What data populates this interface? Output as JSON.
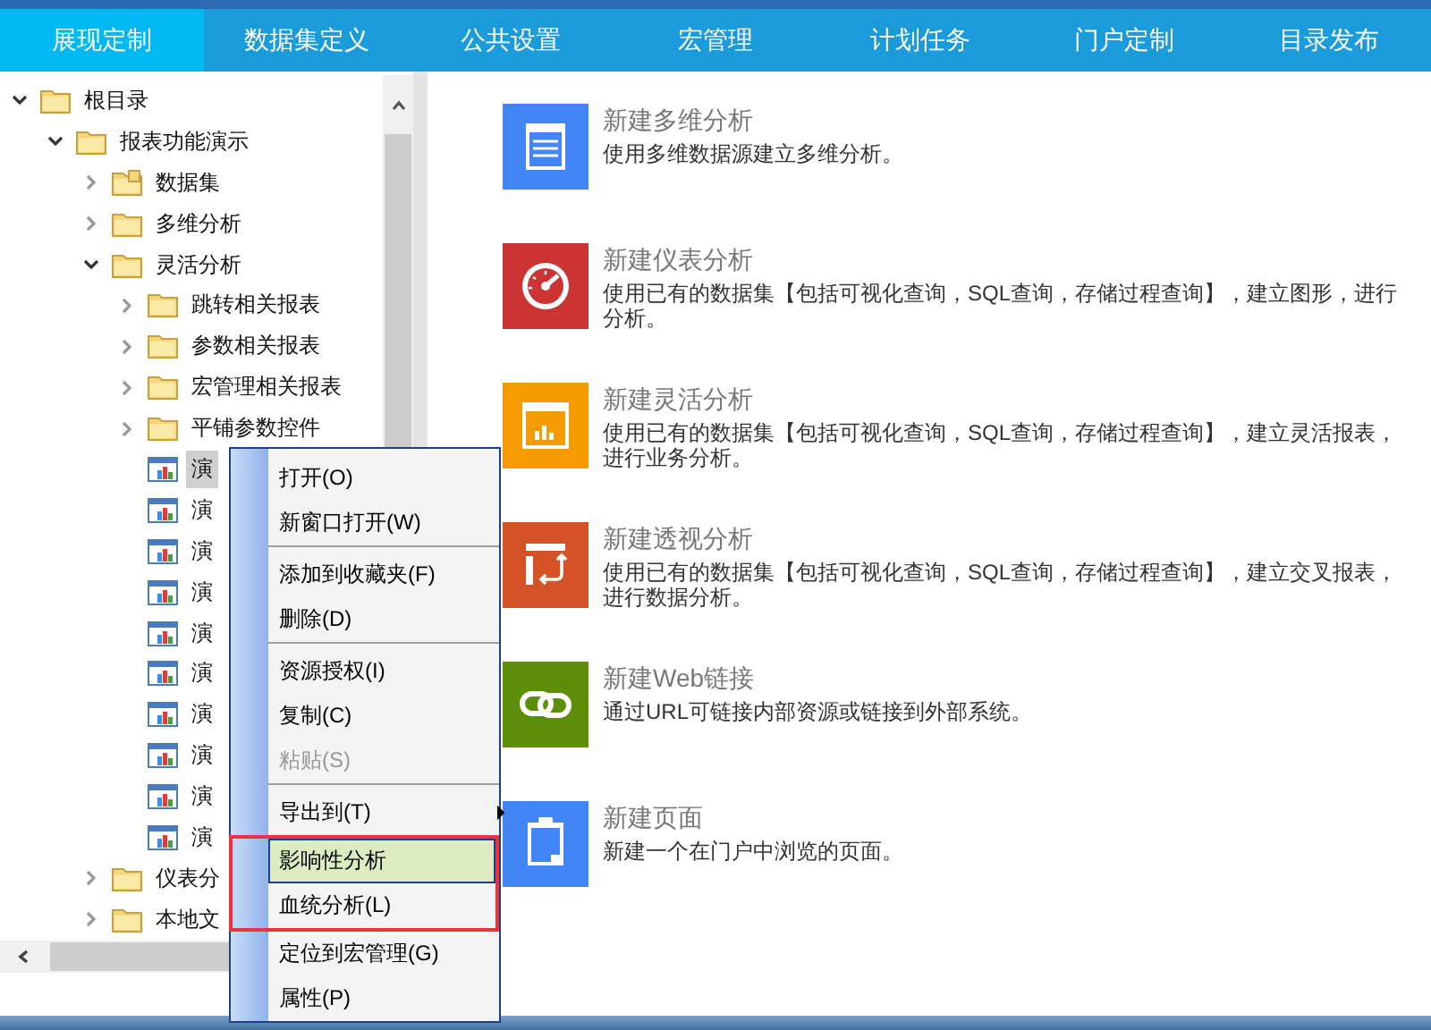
{
  "nav": {
    "tabs": [
      {
        "label": "展现定制",
        "selected": true
      },
      {
        "label": "数据集定义",
        "selected": false
      },
      {
        "label": "公共设置",
        "selected": false
      },
      {
        "label": "宏管理",
        "selected": false
      },
      {
        "label": "计划任务",
        "selected": false
      },
      {
        "label": "门户定制",
        "selected": false
      },
      {
        "label": "目录发布",
        "selected": false
      }
    ]
  },
  "tree": {
    "items": [
      {
        "label": "根目录",
        "kind": "folder",
        "expanded": true,
        "selected": false,
        "children": [
          {
            "label": "报表功能演示",
            "kind": "folder",
            "expanded": true,
            "selected": false,
            "children": [
              {
                "label": "数据集",
                "kind": "dataset",
                "expanded": false,
                "selected": false
              },
              {
                "label": "多维分析",
                "kind": "folder",
                "expanded": false,
                "selected": false
              },
              {
                "label": "灵活分析",
                "kind": "folder",
                "expanded": true,
                "selected": false,
                "children": [
                  {
                    "label": "跳转相关报表",
                    "kind": "folder",
                    "expanded": false,
                    "selected": false
                  },
                  {
                    "label": "参数相关报表",
                    "kind": "folder",
                    "expanded": false,
                    "selected": false
                  },
                  {
                    "label": "宏管理相关报表",
                    "kind": "folder",
                    "expanded": false,
                    "selected": false
                  },
                  {
                    "label": "平铺参数控件",
                    "kind": "folder",
                    "expanded": false,
                    "selected": false
                  },
                  {
                    "label": "演",
                    "kind": "report",
                    "selected": true
                  },
                  {
                    "label": "演",
                    "kind": "report",
                    "selected": false
                  },
                  {
                    "label": "演",
                    "kind": "report",
                    "selected": false
                  },
                  {
                    "label": "演",
                    "kind": "report",
                    "selected": false
                  },
                  {
                    "label": "演",
                    "kind": "report",
                    "selected": false
                  },
                  {
                    "label": "演",
                    "kind": "report",
                    "selected": false
                  },
                  {
                    "label": "演",
                    "kind": "report",
                    "selected": false
                  },
                  {
                    "label": "演",
                    "kind": "report",
                    "selected": false
                  },
                  {
                    "label": "演",
                    "kind": "report",
                    "selected": false
                  },
                  {
                    "label": "演",
                    "kind": "report",
                    "selected": false
                  }
                ]
              },
              {
                "label": "仪表分",
                "kind": "folder",
                "expanded": false,
                "selected": false
              },
              {
                "label": "本地文",
                "kind": "folder",
                "expanded": false,
                "selected": false
              }
            ]
          }
        ]
      }
    ]
  },
  "context_menu": {
    "items": [
      {
        "label": "打开(O)",
        "disabled": false,
        "selected": false,
        "boxed": false,
        "submenu": false,
        "separator_after": false
      },
      {
        "label": "新窗口打开(W)",
        "disabled": false,
        "selected": false,
        "boxed": false,
        "submenu": false,
        "separator_after": true
      },
      {
        "label": "添加到收藏夹(F)",
        "disabled": false,
        "selected": false,
        "boxed": false,
        "submenu": false,
        "separator_after": false
      },
      {
        "label": "删除(D)",
        "disabled": false,
        "selected": false,
        "boxed": false,
        "submenu": false,
        "separator_after": true
      },
      {
        "label": "资源授权(I)",
        "disabled": false,
        "selected": false,
        "boxed": false,
        "submenu": false,
        "separator_after": false
      },
      {
        "label": "复制(C)",
        "disabled": false,
        "selected": false,
        "boxed": false,
        "submenu": false,
        "separator_after": false
      },
      {
        "label": "粘贴(S)",
        "disabled": true,
        "selected": false,
        "boxed": false,
        "submenu": false,
        "separator_after": true
      },
      {
        "label": "导出到(T)",
        "disabled": false,
        "selected": false,
        "boxed": false,
        "submenu": true,
        "separator_after": false
      },
      {
        "label": "影响性分析",
        "disabled": false,
        "selected": true,
        "boxed": true,
        "submenu": false,
        "separator_after": false
      },
      {
        "label": "血统分析(L)",
        "disabled": false,
        "selected": false,
        "boxed": true,
        "submenu": false,
        "separator_after": false
      },
      {
        "label": "定位到宏管理(G)",
        "disabled": false,
        "selected": false,
        "boxed": false,
        "submenu": false,
        "separator_after": false
      },
      {
        "label": "属性(P)",
        "disabled": false,
        "selected": false,
        "boxed": false,
        "submenu": false,
        "separator_after": false
      }
    ]
  },
  "cards": [
    {
      "kind": "multidim",
      "color": "#4285f4",
      "title": "新建多维分析",
      "description": "使用多维数据源建立多维分析。"
    },
    {
      "kind": "gauge",
      "color": "#cc3333",
      "title": "新建仪表分析",
      "description": "使用已有的数据集【包括可视化查询，SQL查询，存储过程查询】，建立图形，进行分析。"
    },
    {
      "kind": "flex",
      "color": "#f59a00",
      "title": "新建灵活分析",
      "description": "使用已有的数据集【包括可视化查询，SQL查询，存储过程查询】，建立灵活报表，进行业务分析。"
    },
    {
      "kind": "pivot",
      "color": "#d45226",
      "title": "新建透视分析",
      "description": "使用已有的数据集【包括可视化查询，SQL查询，存储过程查询】，建立交叉报表，进行数据分析。"
    },
    {
      "kind": "link",
      "color": "#5e8f0a",
      "title": "新建Web链接",
      "description": "通过URL可链接内部资源或链接到外部系统。"
    },
    {
      "kind": "page",
      "color": "#4285f4",
      "title": "新建页面",
      "description": "新建一个在门户中浏览的页面。"
    }
  ]
}
